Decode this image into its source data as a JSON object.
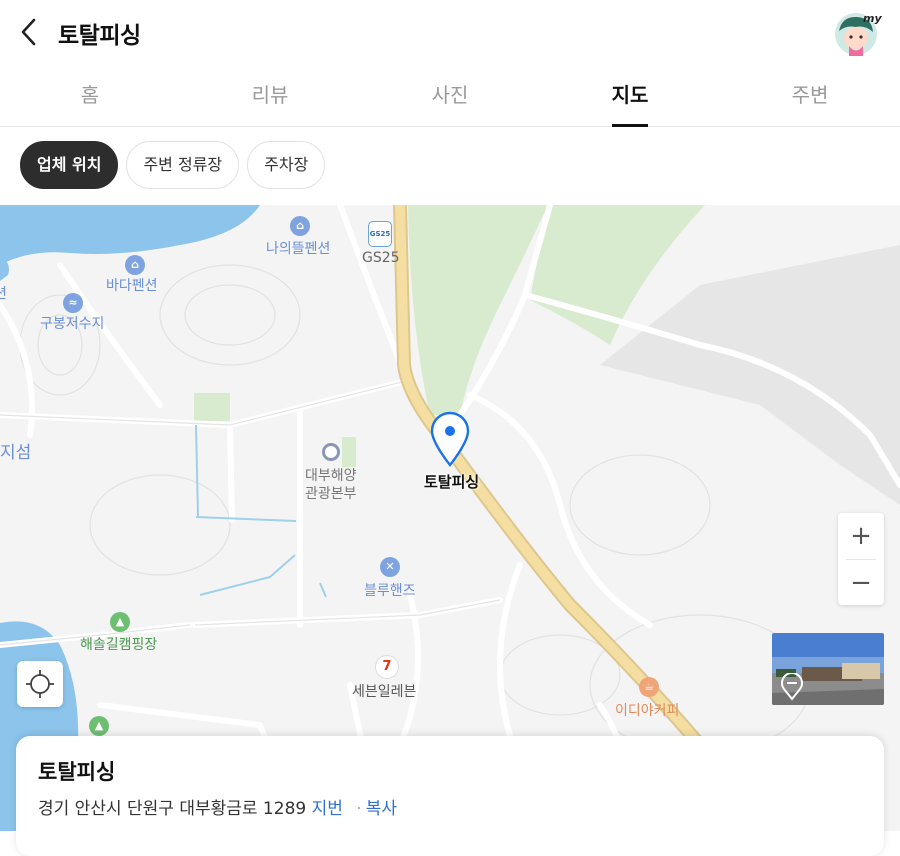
{
  "header": {
    "title": "토탈피싱",
    "avatar_badge": "my"
  },
  "tabs": [
    {
      "label": "홈",
      "active": false
    },
    {
      "label": "리뷰",
      "active": false
    },
    {
      "label": "사진",
      "active": false
    },
    {
      "label": "지도",
      "active": true
    },
    {
      "label": "주변",
      "active": false
    }
  ],
  "chips": [
    {
      "label": "업체 위치",
      "active": true
    },
    {
      "label": "주변 정류장",
      "active": false
    },
    {
      "label": "주차장",
      "active": false
    }
  ],
  "map": {
    "marker_label": "토탈피싱",
    "pois": {
      "naui": "나의뜰펜션",
      "gs25": "GS25",
      "gs25_logo": "GS25",
      "bada": "바다펜션",
      "gubong": "구봉저수지",
      "edge_left": "션",
      "jiseom": "지섬",
      "police_line1": "대부해양",
      "police_line2": "관광본부",
      "blue": "블루핸즈",
      "camping": "해솔길캠핑장",
      "seven": "세븐일레븐",
      "cafe": "이디야커피"
    },
    "zoom_in": "+",
    "zoom_out": "−",
    "colors": {
      "road_main": "#f4dea2",
      "green": "#d8ebcf",
      "water": "#8cc4ec",
      "marker": "#1a73e8"
    }
  },
  "card": {
    "title": "토탈피싱",
    "address": "경기 안산시 단원구 대부황금로 1289",
    "lot_link": "지번",
    "copy_link": "복사"
  }
}
